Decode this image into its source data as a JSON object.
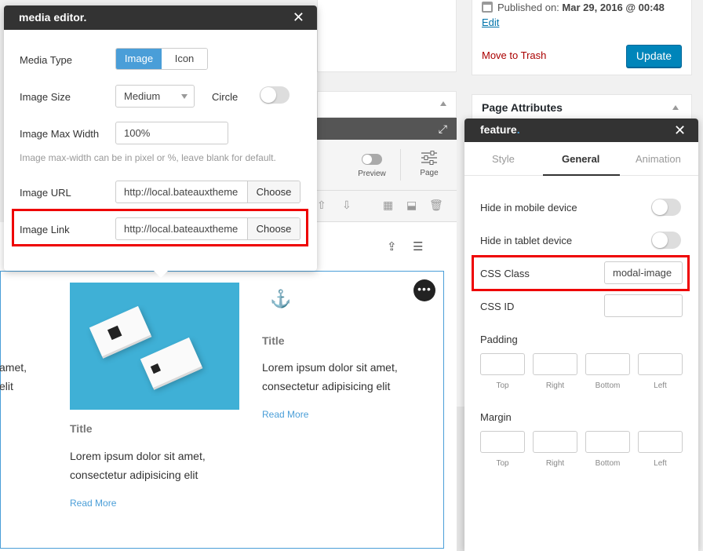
{
  "wp": {
    "published_label": "Published on:",
    "published_value": "Mar 29, 2016 @ 00:48",
    "edit_link": "Edit",
    "trash_link": "Move to Trash",
    "update_button": "Update",
    "page_attributes": "Page Attributes"
  },
  "builder": {
    "toolbar": {
      "preview_label": "Preview",
      "page_label": "Page"
    }
  },
  "cards": [
    {
      "partial_text_1": "amet,",
      "partial_text_2": "elit"
    },
    {
      "title": "Title",
      "body_1": "Lorem ipsum dolor sit amet,",
      "body_2": "consectetur adipisicing elit",
      "link": "Read More"
    },
    {
      "title": "Title",
      "body_1": "Lorem ipsum dolor sit amet,",
      "body_2": "consectetur adipisicing elit",
      "link": "Read More"
    }
  ],
  "media_editor": {
    "title": "media editor.",
    "media_type_label": "Media Type",
    "media_type_options": [
      "Image",
      "Icon"
    ],
    "media_type_selected": "Image",
    "image_size_label": "Image Size",
    "image_size_value": "Medium",
    "circle_label": "Circle",
    "circle_on": false,
    "max_width_label": "Image Max Width",
    "max_width_value": "100%",
    "max_width_help": "Image max-width can be in pixel or %, leave blank for default.",
    "image_url_label": "Image URL",
    "image_url_value": "http://local.bateauxtheme",
    "image_link_label": "Image Link",
    "image_link_value": "http://local.bateauxtheme",
    "choose_label": "Choose"
  },
  "feature_panel": {
    "title": "feature",
    "title_dot": ".",
    "tabs": [
      "Style",
      "General",
      "Animation"
    ],
    "active_tab": "General",
    "hide_mobile_label": "Hide in mobile device",
    "hide_tablet_label": "Hide in tablet device",
    "css_class_label": "CSS Class",
    "css_class_value": "modal-image",
    "css_id_label": "CSS ID",
    "css_id_value": "",
    "padding_label": "Padding",
    "margin_label": "Margin",
    "sides": [
      "Top",
      "Right",
      "Bottom",
      "Left"
    ]
  },
  "colors": {
    "accent": "#4a9ed8",
    "highlight": "#e00000",
    "header_dark": "#333333",
    "wp_primary": "#0085ba"
  }
}
